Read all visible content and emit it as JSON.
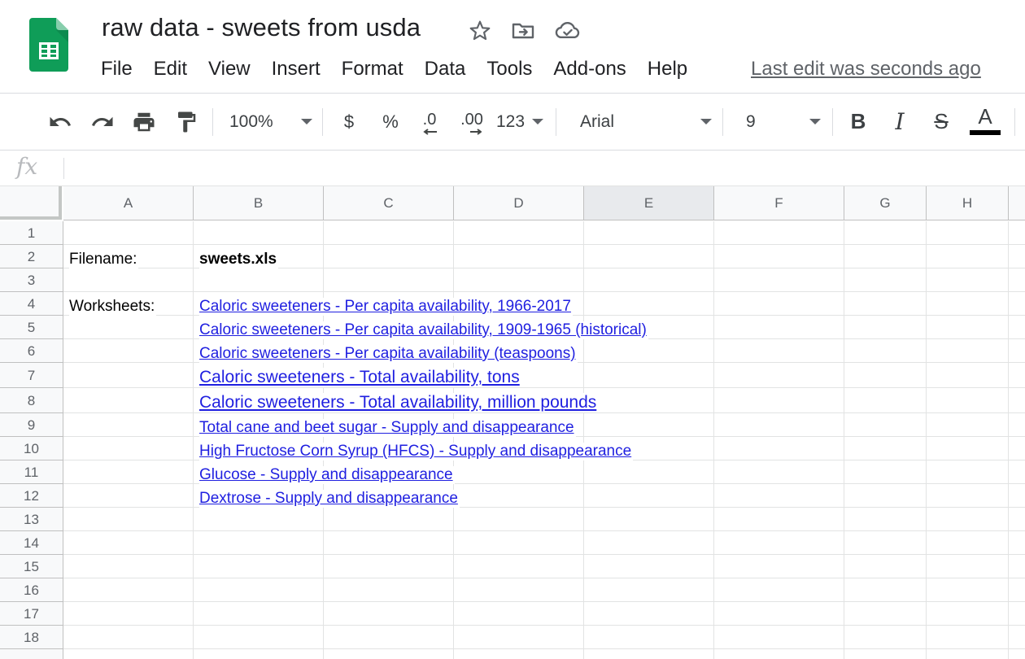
{
  "document": {
    "title": "raw data - sweets from usda",
    "icons": [
      "star-icon",
      "move-to-folder-icon",
      "cloud-saved-icon"
    ]
  },
  "menubar": {
    "items": [
      "File",
      "Edit",
      "View",
      "Insert",
      "Format",
      "Data",
      "Tools",
      "Add-ons",
      "Help"
    ],
    "last_edit": "Last edit was seconds ago"
  },
  "toolbar": {
    "zoom": "100%",
    "currency": "$",
    "percent": "%",
    "decrease_decimal": ".0",
    "increase_decimal": ".00",
    "more_formats": "123",
    "font": "Arial",
    "font_size": "9",
    "bold": "B",
    "italic": "I",
    "strikethrough": "S",
    "text_color": "A",
    "text_color_value": "#000000"
  },
  "formula_bar": {
    "fx": "fx",
    "value": ""
  },
  "sheet": {
    "columns": [
      "A",
      "B",
      "C",
      "D",
      "E",
      "F",
      "G",
      "H"
    ],
    "selected_column": "E",
    "rows": [
      "1",
      "2",
      "3",
      "4",
      "5",
      "6",
      "7",
      "8",
      "9",
      "10",
      "11",
      "12",
      "13",
      "14",
      "15",
      "16",
      "17",
      "18"
    ],
    "cells": {
      "A2": "Filename:",
      "B2": "sweets.xls",
      "A4": "Worksheets:",
      "links": [
        "Caloric sweeteners - Per capita availability, 1966-2017",
        "Caloric sweeteners - Per capita availability, 1909-1965 (historical)",
        "Caloric sweeteners - Per capita availability (teaspoons)",
        "Caloric sweeteners - Total availability, tons",
        "Caloric sweeteners - Total availability, million pounds",
        "Total cane and beet sugar - Supply and disappearance",
        "High Fructose Corn Syrup (HFCS) - Supply and disappearance",
        "Glucose - Supply and disappearance",
        "Dextrose - Supply and disappearance"
      ]
    }
  },
  "colors": {
    "brand_green": "#0f9d58",
    "link": "#1f1fe0",
    "header_bg": "#f8f9fa",
    "selected_header_bg": "#e8eaed"
  }
}
